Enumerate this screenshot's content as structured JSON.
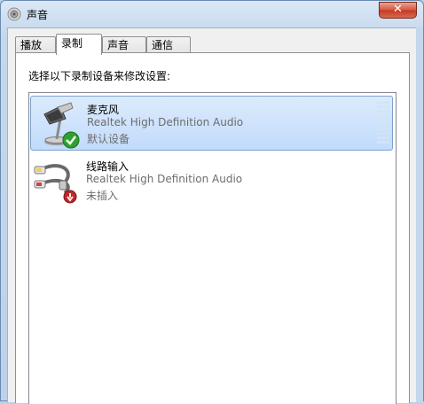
{
  "window": {
    "title": "声音",
    "close_label": "✕"
  },
  "tabs": [
    {
      "label": "播放",
      "active": false
    },
    {
      "label": "录制",
      "active": true
    },
    {
      "label": "声音",
      "active": false
    },
    {
      "label": "通信",
      "active": false
    }
  ],
  "panel": {
    "instruction": "选择以下录制设备来修改设置:"
  },
  "devices": [
    {
      "name": "麦克风",
      "description": "Realtek High Definition Audio",
      "status": "默认设备",
      "icon": "microphone-icon",
      "status_icon": "default-check-icon",
      "selected": true
    },
    {
      "name": "线路输入",
      "description": "Realtek High Definition Audio",
      "status": "未插入",
      "icon": "line-in-cable-icon",
      "status_icon": "unplugged-icon",
      "selected": false
    }
  ],
  "colors": {
    "selection_bg": "#c1dbfc",
    "selection_border": "#7da2ce",
    "check_green": "#2ea12e",
    "unplugged_red": "#c0282a"
  }
}
